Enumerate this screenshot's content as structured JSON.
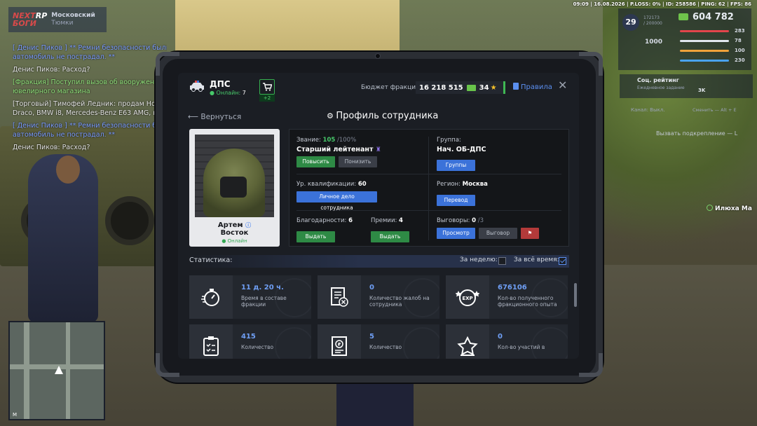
{
  "hud": {
    "status_line": "09:09 | 16.08.2026 | P.LOSS: 0% | ID: 258586 | PING: 62 | FPS: 86",
    "logo_line1": "NEXT",
    "logo_line2": "RP",
    "logo_line3": "БОГИ",
    "city_name": "Московский",
    "city_sub": "Тюмки",
    "level": "29",
    "xp_line1": "172173",
    "xp_line2": "/ 200000",
    "money": "604 782",
    "stats": {
      "hp": "283",
      "armor": "78",
      "hunger": "100",
      "thirst": "230"
    },
    "thousand": "1000",
    "soc_title": "Соц. рейтинг",
    "soc_sub": "Ежедневное задание",
    "soc_val": "3K",
    "radio_label": "Канал: Выкл.",
    "radio_shift": "Сменить — Alt + E",
    "backup": "Вызвать подкрепление — L",
    "player_tag": "Илюха Ма",
    "minimap_label": "M"
  },
  "chat": [
    {
      "text": "[ Денис Пиков ] ** Ремни безопасности были при",
      "color": "#7b9cff"
    },
    {
      "text": "автомобиль не пострадал. **",
      "color": "#7b9cff"
    },
    {
      "text": "Денис Пиков: Расход?",
      "color": "#e2e2e2"
    },
    {
      "text": "[Фракция] Поступил вызов об вооруженном",
      "color": "#8fe07a"
    },
    {
      "text": "ювелирного магазина",
      "color": "#8fe07a"
    },
    {
      "text": "[Торговый] Тимофей Ледник: продам Honda C",
      "color": "#e2e2e2"
    },
    {
      "text": "Draco, BMW i8, Mercedes-Benz E63 AMG, писать",
      "color": "#e2e2e2"
    },
    {
      "text": "[ Денис Пиков ] ** Ремни безопасности были",
      "color": "#7b9cff"
    },
    {
      "text": "автомобиль не пострадал. **",
      "color": "#7b9cff"
    },
    {
      "text": "Денис Пиков: Расход?",
      "color": "#e2e2e2"
    }
  ],
  "header": {
    "faction": "ДПС",
    "online_label": "Онлайн:",
    "online_count": "7",
    "cart_badge": "+2",
    "budget_label": "Бюджет фракции:",
    "budget_value": "16 218 515",
    "budget_points": "34",
    "rules": "Правила"
  },
  "nav": {
    "back": "Вернуться",
    "title": "Профиль сотрудника"
  },
  "profile": {
    "first_name": "Артем",
    "last_name": "Восток",
    "status": "Онлайн"
  },
  "info": {
    "rank_label": "Звание:",
    "rank_progress": "105",
    "rank_max": "/100%",
    "rank_name": "Старший лейтенант",
    "promote": "Повысить",
    "demote": "Понизить",
    "group_label": "Группа:",
    "group_name": "Нач. ОБ-ДПС",
    "groups_btn": "Группы",
    "qual_label": "Ур. квалификации:",
    "qual_value": "60",
    "personal_file": "Личное дело сотрудника",
    "region_label": "Регион:",
    "region_value": "Москва",
    "transfer": "Перевод",
    "thanks_label": "Благодарности:",
    "thanks_value": "6",
    "thanks_btn": "Выдать",
    "bonus_label": "Премии:",
    "bonus_value": "4",
    "bonus_btn": "Выдать",
    "warn_label": "Выговоры:",
    "warn_value": "0",
    "warn_max": "/3",
    "view_btn": "Просмотр",
    "warn_btn": "Выговор"
  },
  "stats": {
    "label": "Статистика:",
    "week": "За неделю:",
    "all_time": "За всё время:",
    "cards": [
      {
        "value": "11 д. 20 ч.",
        "text": "Время в составе фракции",
        "icon": "stopwatch-icon"
      },
      {
        "value": "0",
        "text": "Количество жалоб на сотрудника",
        "icon": "complaint-icon"
      },
      {
        "value": "676106",
        "text": "Кол-во полученного фракционного опыта",
        "icon": "exp-icon"
      },
      {
        "value": "415",
        "text": "Количество",
        "icon": "clipboard-icon"
      },
      {
        "value": "5",
        "text": "Количество",
        "icon": "receipt-icon"
      },
      {
        "value": "0",
        "text": "Кол-во участий в",
        "icon": "star-icon"
      }
    ]
  },
  "colors": {
    "accent_blue": "#3b72d9",
    "accent_green": "#2e8a45",
    "panel": "#1b1e24"
  }
}
